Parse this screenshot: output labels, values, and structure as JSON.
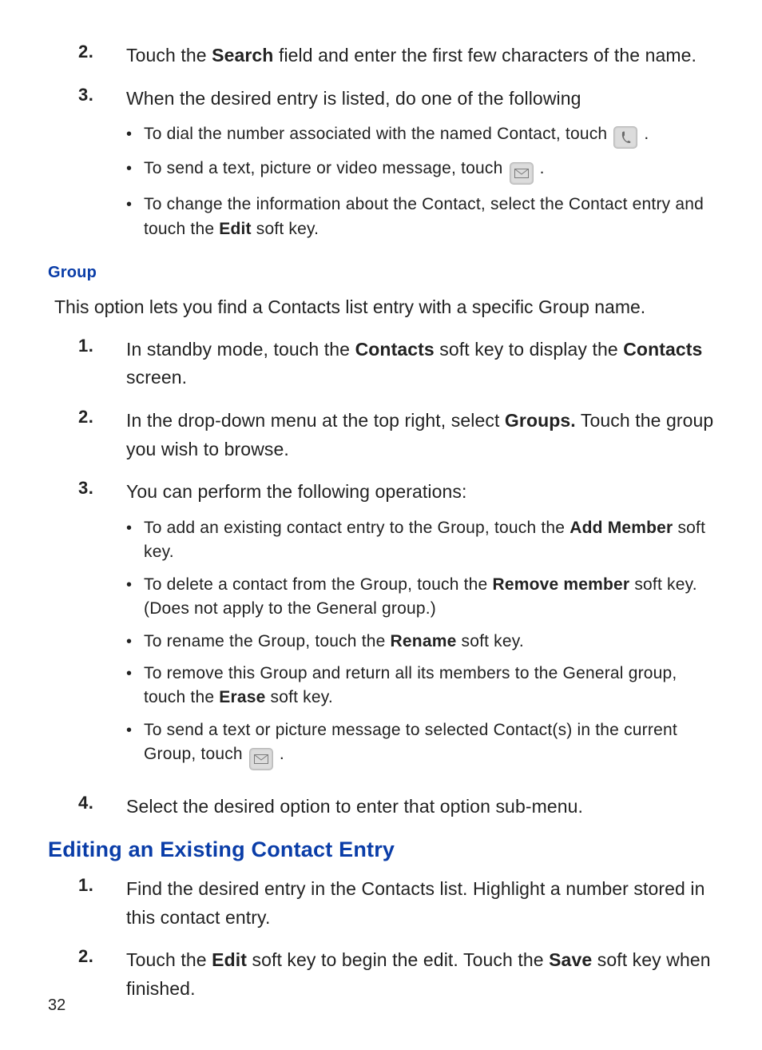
{
  "top_list": {
    "item2": {
      "num": "2.",
      "pre": "Touch the ",
      "bold": "Search",
      "post": " field and enter the first few characters of the name."
    },
    "item3": {
      "num": "3.",
      "text": "When the desired entry is listed, do one of the following",
      "bullets": {
        "b1": {
          "text": "To dial the number associated with the named Contact, touch ",
          "after": " ."
        },
        "b2": {
          "text": "To send a text, picture or video message, touch ",
          "after": " ."
        },
        "b3": {
          "pre": "To change the information about the Contact, select the Contact entry and touch the ",
          "bold": "Edit",
          "post": " soft key."
        }
      }
    }
  },
  "group_heading": "Group",
  "group_para": "This option lets you find a Contacts list entry with a specific Group name.",
  "group_list": {
    "i1": {
      "num": "1.",
      "pre": "In standby mode, touch the ",
      "b1": "Contacts",
      "mid": " soft key to display the ",
      "b2": "Contacts",
      "post": " screen."
    },
    "i2": {
      "num": "2.",
      "pre": "In the drop-down menu at the top right, select ",
      "b1": "Groups.",
      "post": " Touch the group you wish to browse."
    },
    "i3": {
      "num": "3.",
      "text": "You can perform the following operations:",
      "bullets": {
        "b1": {
          "pre": "To add an existing contact entry to the Group, touch the ",
          "bold": "Add Member",
          "post": " soft key."
        },
        "b2": {
          "pre": "To delete a contact from the Group, touch the ",
          "bold": "Remove member",
          "post": " soft key. (Does not apply to the General group.)"
        },
        "b3": {
          "pre": "To rename the Group, touch the ",
          "bold": "Rename",
          "post": " soft key."
        },
        "b4": {
          "pre": "To remove this Group and return all its members to the General group, touch the ",
          "bold": "Erase",
          "post": " soft key."
        },
        "b5": {
          "text": "To send a text or picture message to selected Contact(s) in the current Group, touch ",
          "after": " ."
        }
      }
    },
    "i4": {
      "num": "4.",
      "text": "Select the desired option to enter that option sub-menu."
    }
  },
  "section_heading": "Editing an Existing Contact Entry",
  "edit_list": {
    "i1": {
      "num": "1.",
      "text": "Find the desired entry in the Contacts list. Highlight a number stored in this contact entry."
    },
    "i2": {
      "num": "2.",
      "pre": "Touch the ",
      "b1": "Edit",
      "mid": " soft key to begin the edit. Touch the ",
      "b2": "Save",
      "post": " soft key when finished."
    }
  },
  "page_number": "32"
}
